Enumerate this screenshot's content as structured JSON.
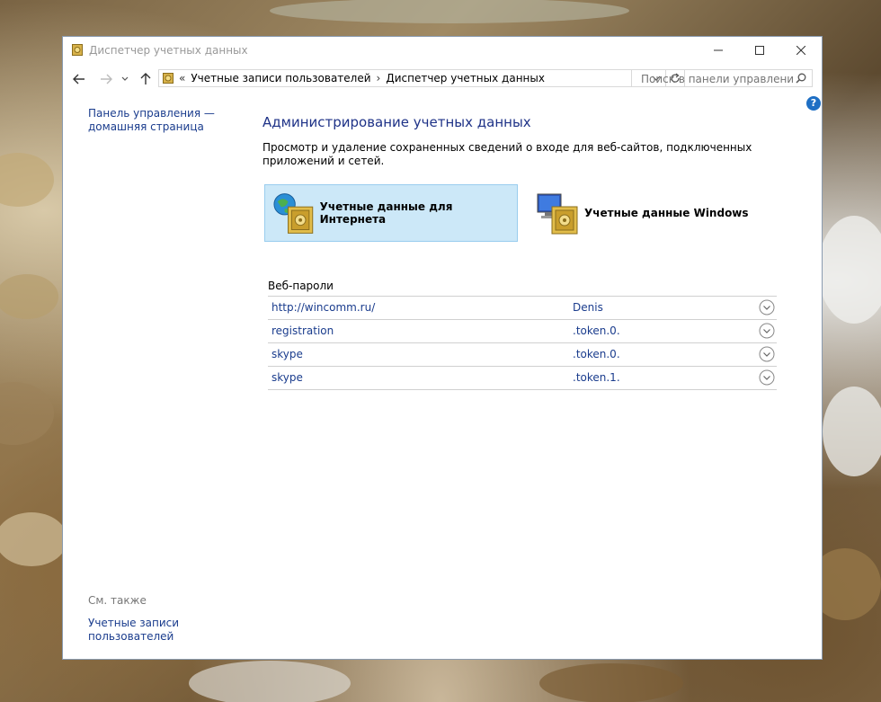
{
  "window": {
    "title": "Диспетчер учетных данных"
  },
  "nav": {
    "breadcrumb_prefix": "«",
    "breadcrumbs": [
      "Учетные записи пользователей",
      "Диспетчер учетных данных"
    ],
    "breadcrumb_sep": "›",
    "search_placeholder": "Поиск в панели управления"
  },
  "left_pane": {
    "home_link": "Панель управления — домашняя страница",
    "see_also": "См. также",
    "user_accounts_link": "Учетные записи пользователей"
  },
  "main": {
    "title": "Администрирование учетных данных",
    "description": "Просмотр и удаление сохраненных сведений о входе для веб-сайтов, подключенных приложений и сетей.",
    "web_credentials": "Учетные данные для Интернета",
    "windows_credentials": "Учетные данные Windows",
    "section_title": "Веб-пароли",
    "entries": [
      {
        "site": "http://wincomm.ru/",
        "user": "Denis"
      },
      {
        "site": "registration",
        "user": ".token.0."
      },
      {
        "site": "skype",
        "user": ".token.0."
      },
      {
        "site": "skype",
        "user": ".token.1."
      }
    ]
  },
  "colors": {
    "link": "#1a3c8d",
    "selected_bg": "#cce8f8",
    "help": "#1e6fc4"
  }
}
